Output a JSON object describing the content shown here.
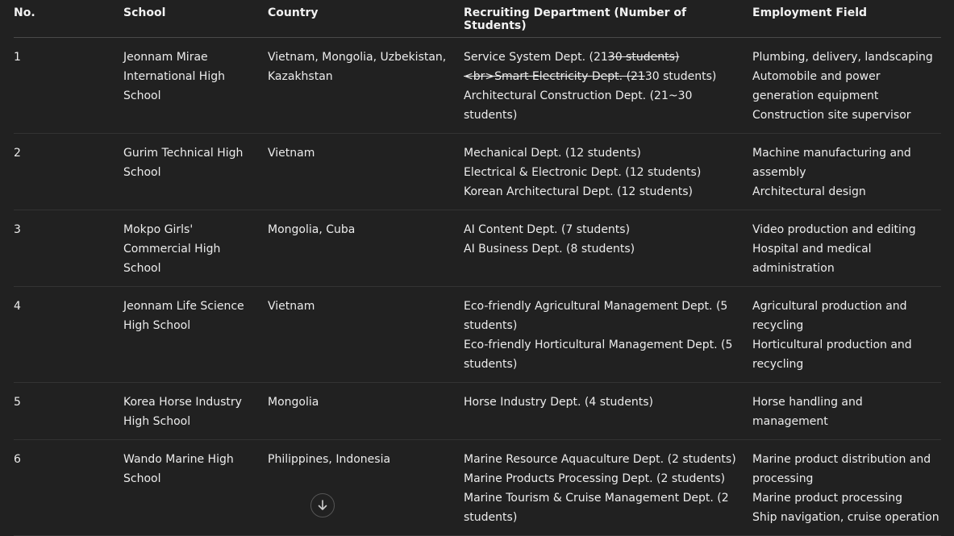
{
  "table": {
    "headers": {
      "no": "No.",
      "school": "School",
      "country": "Country",
      "dept": "Recruiting Department (Number of Students)",
      "field": "Employment Field"
    },
    "rows": [
      {
        "no": "1",
        "school": "Jeonnam Mirae International High School",
        "country": "Vietnam, Mongolia, Uzbekistan, Kazakhstan",
        "dept_prefix": "Service System Dept. (21",
        "dept_strike": "30 students)<br>Smart Electricity Dept. (21",
        "dept_suffix": "30 students)",
        "dept_line2": "Architectural Construction Dept. (21~30 students)",
        "fields": [
          "Plumbing, delivery, landscaping",
          "Automobile and power generation equipment",
          "Construction site supervisor"
        ]
      },
      {
        "no": "2",
        "school": "Gurim Technical High School",
        "country": "Vietnam",
        "depts": [
          "Mechanical Dept. (12 students)",
          "Electrical & Electronic Dept. (12 students)",
          "Korean Architectural Dept. (12 students)"
        ],
        "fields": [
          "Machine manufacturing and assembly",
          "Architectural design"
        ]
      },
      {
        "no": "3",
        "school": "Mokpo Girls' Commercial High School",
        "country": "Mongolia, Cuba",
        "depts": [
          "AI Content Dept. (7 students)",
          "AI Business Dept. (8 students)"
        ],
        "fields": [
          "Video production and editing",
          "Hospital and medical administration"
        ]
      },
      {
        "no": "4",
        "school": "Jeonnam Life Science High School",
        "country": "Vietnam",
        "depts": [
          "Eco-friendly Agricultural Management Dept. (5 students)",
          "Eco-friendly Horticultural Management Dept. (5 students)"
        ],
        "fields": [
          "Agricultural production and recycling",
          "Horticultural production and recycling"
        ]
      },
      {
        "no": "5",
        "school": "Korea Horse Industry High School",
        "country": "Mongolia",
        "depts": [
          "Horse Industry Dept. (4 students)"
        ],
        "fields": [
          "Horse handling and management"
        ]
      },
      {
        "no": "6",
        "school": "Wando Marine High School",
        "country": "Philippines, Indonesia",
        "depts": [
          "Marine Resource Aquaculture Dept. (2 students)",
          "Marine Products Processing Dept. (2 students)",
          "Marine Tourism & Cruise Management Dept. (2 students)"
        ],
        "fields": [
          "Marine product distribution and processing",
          "Marine product processing",
          "Ship navigation, cruise operation"
        ]
      }
    ]
  },
  "scroll_button": {
    "icon": "arrow-down-icon"
  }
}
